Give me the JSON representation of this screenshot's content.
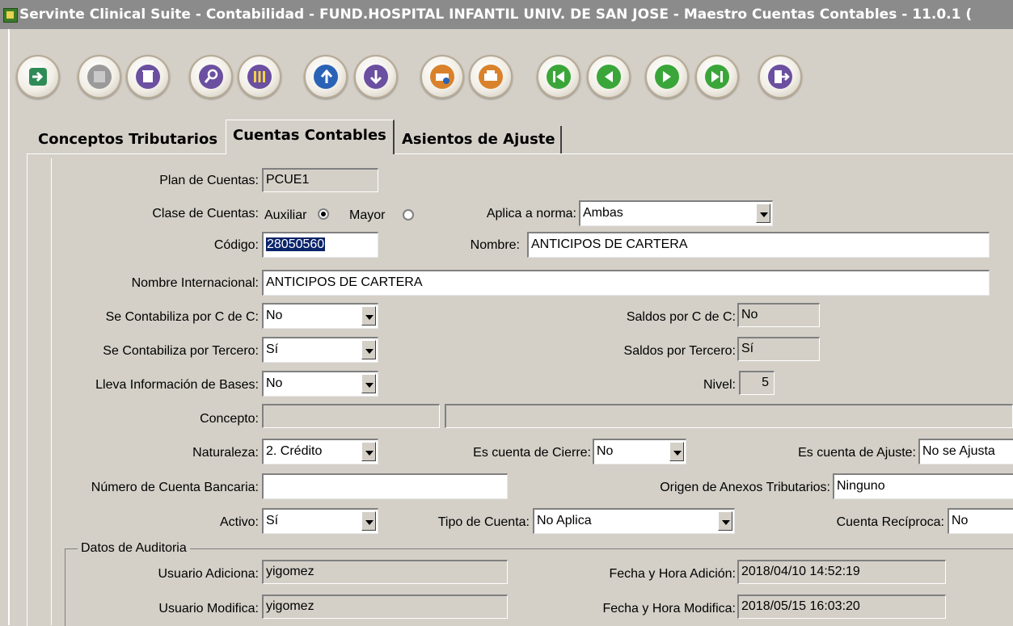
{
  "title": "Servinte Clinical Suite - Contabilidad - FUND.HOSPITAL INFANTIL UNIV. DE SAN JOSE - Maestro Cuentas Contables - 11.0.1 (",
  "toolbar": [
    {
      "name": "enter-icon",
      "color": "#2e8b57"
    },
    {
      "name": "save-icon",
      "color": "#9a9a9a"
    },
    {
      "name": "delete-icon",
      "color": "#6b4fa0"
    },
    {
      "name": "search-icon",
      "color": "#6b4fa0"
    },
    {
      "name": "columns-icon",
      "color": "#6b4fa0"
    },
    {
      "name": "undo-icon",
      "color": "#2a63b5"
    },
    {
      "name": "download-icon",
      "color": "#6b4fa0"
    },
    {
      "name": "print-setup-icon",
      "color": "#d9822b"
    },
    {
      "name": "print-icon",
      "color": "#d9822b"
    },
    {
      "name": "first-record-icon",
      "color": "#3aa63a"
    },
    {
      "name": "previous-record-icon",
      "color": "#3aa63a"
    },
    {
      "name": "next-record-icon",
      "color": "#3aa63a"
    },
    {
      "name": "last-record-icon",
      "color": "#3aa63a"
    },
    {
      "name": "exit-icon",
      "color": "#6b4fa0"
    }
  ],
  "tabs": [
    "Conceptos Tributarios",
    "Cuentas Contables",
    "Asientos de Ajuste"
  ],
  "form": {
    "plan_label": "Plan de Cuentas:",
    "plan_value": "PCUE1",
    "clase_label": "Clase de Cuentas:",
    "auxiliar_label": "Auxiliar",
    "mayor_label": "Mayor",
    "aplica_label": "Aplica a norma:",
    "aplica_value": "Ambas",
    "codigo_label": "Código:",
    "codigo_value": "28050560",
    "nombre_label": "Nombre:",
    "nombre_value": "ANTICIPOS DE CARTERA",
    "nombre_int_label": "Nombre Internacional:",
    "nombre_int_value": "ANTICIPOS DE CARTERA",
    "contab_cc_label": "Se Contabiliza por C de C:",
    "contab_cc_value": "No",
    "saldos_cc_label": "Saldos por C de C:",
    "saldos_cc_value": "No",
    "contab_ter_label": "Se Contabiliza por Tercero:",
    "contab_ter_value": "Sí",
    "saldos_ter_label": "Saldos por Tercero:",
    "saldos_ter_value": "Sí",
    "bases_label": "Lleva Información de Bases:",
    "bases_value": "No",
    "nivel_label": "Nivel:",
    "nivel_value": "5",
    "concepto_label": "Concepto:",
    "concepto_value": "",
    "concepto_desc": "",
    "naturaleza_label": "Naturaleza:",
    "naturaleza_value": "2. Crédito",
    "cierre_label": "Es cuenta de Cierre:",
    "cierre_value": "No",
    "ajuste_label": "Es cuenta de Ajuste:",
    "ajuste_value": "No se Ajusta",
    "banco_label": "Número de Cuenta Bancaria:",
    "banco_value": "",
    "origen_label": "Origen de Anexos Tributarios:",
    "origen_value": "Ninguno",
    "activo_label": "Activo:",
    "activo_value": "Sí",
    "tipo_label": "Tipo de Cuenta:",
    "tipo_value": "No Aplica",
    "reciproca_label": "Cuenta Recíproca:",
    "reciproca_value": "No"
  },
  "auditoria": {
    "title": "Datos de Auditoria",
    "usuario_adiciona_label": "Usuario Adiciona:",
    "usuario_adiciona_value": "yigomez",
    "fecha_adicion_label": "Fecha y Hora Adición:",
    "fecha_adicion_value": "2018/04/10 14:52:19",
    "usuario_modifica_label": "Usuario Modifica:",
    "usuario_modifica_value": "yigomez",
    "fecha_modifica_label": "Fecha y Hora Modifica:",
    "fecha_modifica_value": "2018/05/15 16:03:20"
  }
}
